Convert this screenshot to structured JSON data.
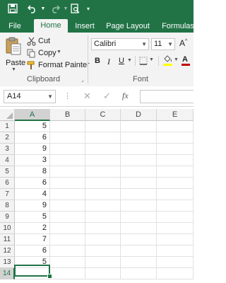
{
  "colors": {
    "brand": "#217346",
    "ribbon_bg": "#f3f3f3",
    "font_color_bar": "#c00000",
    "highlight_bar": "#ffff00"
  },
  "qat": {
    "icons": [
      "save-icon",
      "undo-icon",
      "redo-icon",
      "print-preview-icon",
      "customize-icon"
    ]
  },
  "tabs": [
    {
      "label": "File",
      "active": false
    },
    {
      "label": "Home",
      "active": true
    },
    {
      "label": "Insert",
      "active": false
    },
    {
      "label": "Page Layout",
      "active": false
    },
    {
      "label": "Formulas",
      "active": false
    }
  ],
  "ribbon": {
    "clipboard": {
      "paste_label": "Paste",
      "cut_label": "Cut",
      "copy_label": "Copy",
      "format_painter_label": "Format Painter",
      "group_label": "Clipboard"
    },
    "font": {
      "font_name": "Calibri",
      "font_size": "11",
      "bold_label": "B",
      "italic_label": "I",
      "underline_label": "U",
      "font_color_label": "A",
      "group_label": "Font"
    }
  },
  "formula_bar": {
    "name_box": "A14",
    "fx_label": "fx",
    "formula": ""
  },
  "sheet": {
    "columns": [
      "A",
      "B",
      "C",
      "D",
      "E"
    ],
    "selected_column": "A",
    "rows": [
      "1",
      "2",
      "3",
      "4",
      "5",
      "6",
      "7",
      "8",
      "9",
      "10",
      "11",
      "12",
      "13",
      "14"
    ],
    "selected_row": "14",
    "col_a_values": [
      "5",
      "6",
      "9",
      "3",
      "8",
      "6",
      "4",
      "9",
      "5",
      "2",
      "7",
      "6",
      "5",
      ""
    ]
  }
}
